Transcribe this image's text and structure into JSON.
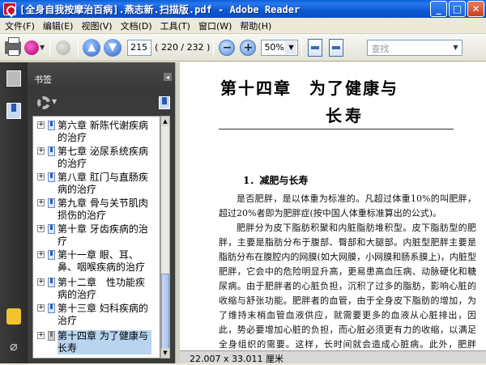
{
  "window": {
    "title": "[全身自我按摩治百病].燕志新.扫描版.pdf - Adobe Reader",
    "minimize": "_",
    "maximize": "□",
    "close": "✕"
  },
  "menu": [
    "文件(F)",
    "编辑(E)",
    "视图(V)",
    "文档(D)",
    "工具(T)",
    "窗口(W)",
    "帮助(H)"
  ],
  "toolbar": {
    "current_page": "215",
    "page_total": "( 220 / 232 )",
    "zoom_out": "−",
    "zoom_in": "+",
    "zoom": "50%",
    "search_placeholder": "查找"
  },
  "panel": {
    "title": "书签",
    "collapse": "◂"
  },
  "bookmarks": [
    {
      "label": "第六章 新陈代谢疾病的治疗",
      "selected": false
    },
    {
      "label": "第七章 泌尿系统疾病的治疗",
      "selected": false
    },
    {
      "label": "第八章 肛门与直肠疾病的治疗",
      "selected": false
    },
    {
      "label": "第九章 骨与关节肌肉损伤的治疗",
      "selected": false
    },
    {
      "label": "第十章 牙齿疾病的治疗",
      "selected": false
    },
    {
      "label": "第十一章 眼、耳、鼻、咽喉疾病的治疗",
      "selected": false
    },
    {
      "label": "第十二章　性功能疾病的治疗",
      "selected": false
    },
    {
      "label": "第十三章 妇科疾病的治疗",
      "selected": false
    },
    {
      "label": "第十四章 为了健康与长寿",
      "selected": true
    }
  ],
  "document": {
    "chapter_title_line1": "第十四章　为了健康与",
    "chapter_title_line2": "长寿",
    "section_title": "1．减肥与长寿",
    "paragraphs": [
      "是否肥胖，是以体重为标准的。凡超过体重10%的叫肥胖，超过20%者即为肥胖症(按中国人体重标准算出的公式)。",
      "肥胖分为皮下脂肪积聚和内脏脂肪堆积型。皮下脂肪型的肥胖，主要是脂肪分布于腹部、臀部和大腿部。内脏型肥胖主要是脂肪分布在腹腔内的网膜(如大网膜，小网膜和肠系膜上)，内脏型肥胖，它会中的危险明显升高，更易患高血压病、动脉硬化和糖尿病。由于肥胖者的心脏负担，沉积了过多的脂肪，影响心脏的收缩与舒张功能。肥胖者的血管，由于全身皮下脂肪的增加，为了维持末梢血管血液供应，就需要更多的血液从心脏排出，因此，势必要增加心脏的负担，而心脏必须更有力的收缩，以满足全身组织的需要。这样，长时间就会造成心脏病。此外，肥胖者……"
    ]
  },
  "status": {
    "doc_size": "22.007 x 33.011 厘米"
  },
  "colors": {
    "titlebar": "#0b58d3",
    "panel_bg": "#3c3c3c",
    "selected_bookmark": "#b8d4ee"
  }
}
